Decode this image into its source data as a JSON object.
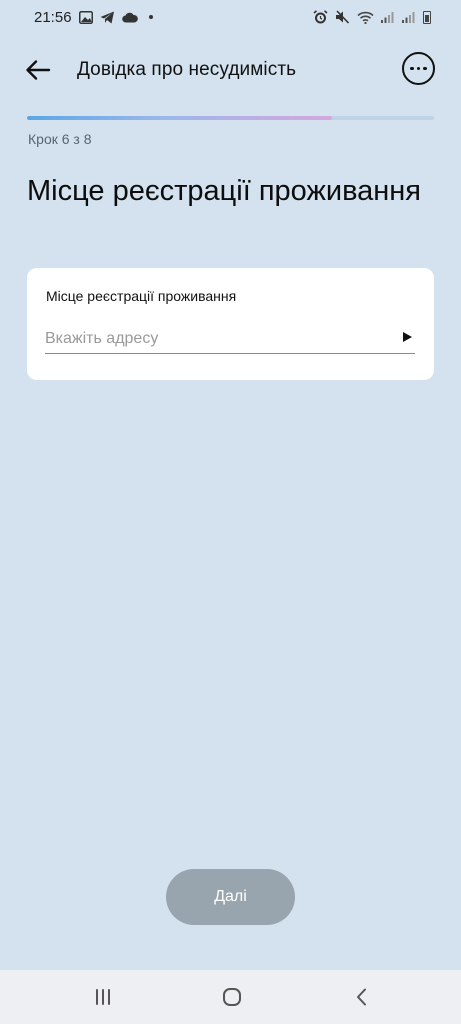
{
  "status_bar": {
    "time": "21:56"
  },
  "header": {
    "title": "Довідка про несудимість"
  },
  "progress": {
    "fraction": 0.75,
    "step_text": "Крок 6 з 8"
  },
  "page": {
    "title": "Місце реєстрації проживання"
  },
  "card": {
    "field_label": "Місце реєстрації проживання",
    "address_placeholder": "Вкажіть адресу",
    "address_value": ""
  },
  "actions": {
    "next_label": "Далі"
  },
  "colors": {
    "background": "#d3e2ee",
    "card": "#ffffff",
    "next_button_disabled": "#98a5ae",
    "progress_track": "#bfd3e6",
    "progress_gradient_start": "#5aa7e6",
    "progress_gradient_end": "#d6a7dc"
  },
  "icons": {
    "status_left": [
      "image-icon",
      "telegram-icon",
      "cloud-icon",
      "dot-icon"
    ],
    "status_right": [
      "alarm-icon",
      "mute-icon",
      "wifi-icon",
      "signal-icon",
      "signal-icon",
      "battery-icon"
    ],
    "header": [
      "back-arrow-icon",
      "more-icon"
    ],
    "field": [
      "dropdown-arrow-icon"
    ],
    "nav": [
      "recent-apps-icon",
      "home-icon",
      "nav-back-icon"
    ]
  }
}
